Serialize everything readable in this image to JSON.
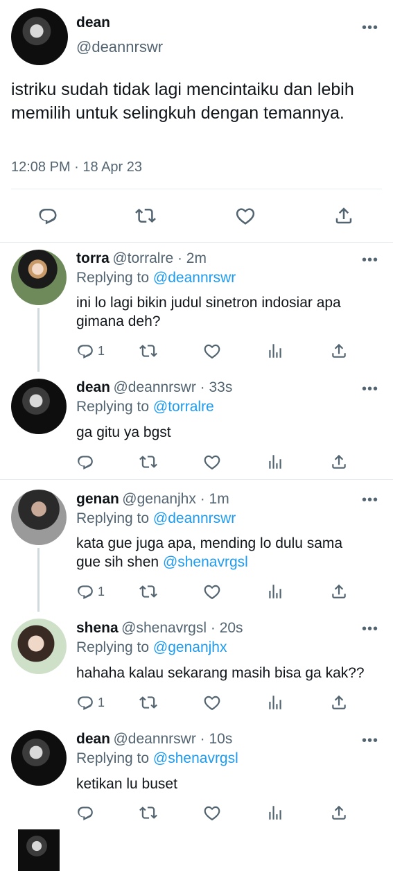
{
  "main_tweet": {
    "name": "dean",
    "handle": "@deannrswr",
    "text": "istriku sudah tidak lagi mencintaiku dan lebih memilih untuk selingkuh dengan temannya.",
    "timestamp": "12:08 PM · 18 Apr 23"
  },
  "more_glyph": "•••",
  "replies": [
    {
      "name": "torra",
      "handle_time": "@torralre · 2m",
      "replying_prefix": "Replying to",
      "replying_to": "@deannrswr",
      "text": "ini lo lagi bikin judul sinetron indosiar apa gimana deh?",
      "reply_count": "1"
    },
    {
      "name": "dean",
      "handle_time": "@deannrswr · 33s",
      "replying_prefix": "Replying to",
      "replying_to": "@torralre",
      "text": "ga gitu ya bgst",
      "reply_count": ""
    },
    {
      "name": "genan",
      "handle_time": "@genanjhx · 1m",
      "replying_prefix": "Replying to",
      "replying_to": "@deannrswr",
      "text_line1": "kata gue juga apa, mending lo dulu sama",
      "text_line2": "gue sih shen",
      "text_mention": "@shenavrgsl",
      "reply_count": "1"
    },
    {
      "name": "shena",
      "handle_time": "@shenavrgsl · 20s",
      "replying_prefix": "Replying to",
      "replying_to": "@genanjhx",
      "text": "hahaha kalau sekarang masih bisa ga kak??",
      "reply_count": "1"
    },
    {
      "name": "dean",
      "handle_time": "@deannrswr · 10s",
      "replying_prefix": "Replying to",
      "replying_to": "@shenavrgsl",
      "text": "ketikan lu buset",
      "reply_count": ""
    }
  ],
  "colors": {
    "text": "#0f1419",
    "secondary": "#536471",
    "accent": "#1d9bf0",
    "divider": "#e6ecf0"
  }
}
